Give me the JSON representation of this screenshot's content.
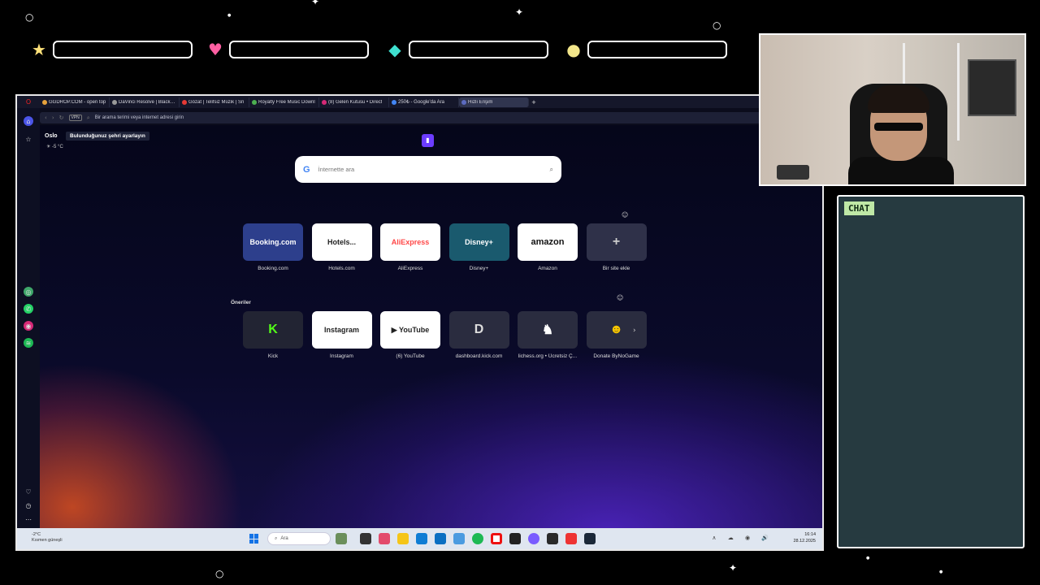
{
  "hud": {
    "icons": [
      "star-icon",
      "heart-icon",
      "diamond-icon",
      "coin-icon"
    ],
    "colors": {
      "star": "#ffe27a",
      "heart": "#ff5fa2",
      "diamond": "#3fe0d0",
      "coin": "#f2e68a"
    }
  },
  "browser": {
    "tabs": [
      {
        "label": "GGDROP.COM - open top",
        "color": "#e6a23c"
      },
      {
        "label": "DaVinci Resolve | Blackmagic",
        "color": "#999999"
      },
      {
        "label": "Gözat | Telifsiz Müzik | Sn",
        "color": "#e53935"
      },
      {
        "label": "Royalty Free Music Downl",
        "color": "#4caf50"
      },
      {
        "label": "(8) Gelen Kutusu • Direct",
        "color": "#d62976"
      },
      {
        "label": "250₺ - Google'da Ara",
        "color": "#4285f4"
      },
      {
        "label": "Hızlı Erişim",
        "color": "#5c6bc0"
      }
    ],
    "address": {
      "vpn": "VPN",
      "placeholder": "Bir arama terimi veya internet adresi girin"
    }
  },
  "weather": {
    "city": "Oslo",
    "set_location": "Bulunduğunuz şehri ayarlayın",
    "temp": "-5 °C"
  },
  "search": {
    "logo": "G",
    "placeholder": "İnternette ara"
  },
  "speed_dial": [
    {
      "label": "Booking.com",
      "logo": "Booking.com",
      "bg": "#2d3f8c",
      "fg": "#ffffff"
    },
    {
      "label": "Hotels.com",
      "logo": "Hotels...",
      "bg": "#ffffff",
      "fg": "#222222"
    },
    {
      "label": "AliExpress",
      "logo": "AliExpress",
      "bg": "#ffffff",
      "fg": "#ff4747"
    },
    {
      "label": "Disney+",
      "logo": "Disney+",
      "bg": "#1a5a6e",
      "fg": "#ffffff"
    },
    {
      "label": "Amazon",
      "logo": "amazon",
      "bg": "#ffffff",
      "fg": "#111111"
    },
    {
      "label": "Bir site ekle",
      "logo": "+",
      "bg": "#2f3149",
      "fg": "#cccccc"
    }
  ],
  "suggestions_title": "Öneriler",
  "suggestions": [
    {
      "label": "Kick",
      "logo": "K",
      "bg": "#222433",
      "fg": "#53fc18"
    },
    {
      "label": "Instagram",
      "logo": "Instagram",
      "bg": "#ffffff",
      "fg": "#222222"
    },
    {
      "label": "(6) YouTube",
      "logo": "▶ YouTube",
      "bg": "#ffffff",
      "fg": "#222222"
    },
    {
      "label": "dashboard.kick.com",
      "logo": "D",
      "bg": "#2a2c3f",
      "fg": "#dddddd"
    },
    {
      "label": "lichess.org • Ücretsiz Ç...",
      "logo": "♞",
      "bg": "#2a2c3f",
      "fg": "#ffffff"
    },
    {
      "label": "Donate ByNoGame",
      "logo": "☻",
      "bg": "#2a2c3f",
      "fg": "#f5c400"
    }
  ],
  "taskbar": {
    "weather_temp": "-2°C",
    "weather_desc": "Kısmen güneşli",
    "search_placeholder": "Ara",
    "time": "16:14",
    "date": "28.12.2025",
    "tray_icons": "∧ ☁ ◉ 🔊"
  },
  "chat": {
    "title": "CHAT"
  }
}
